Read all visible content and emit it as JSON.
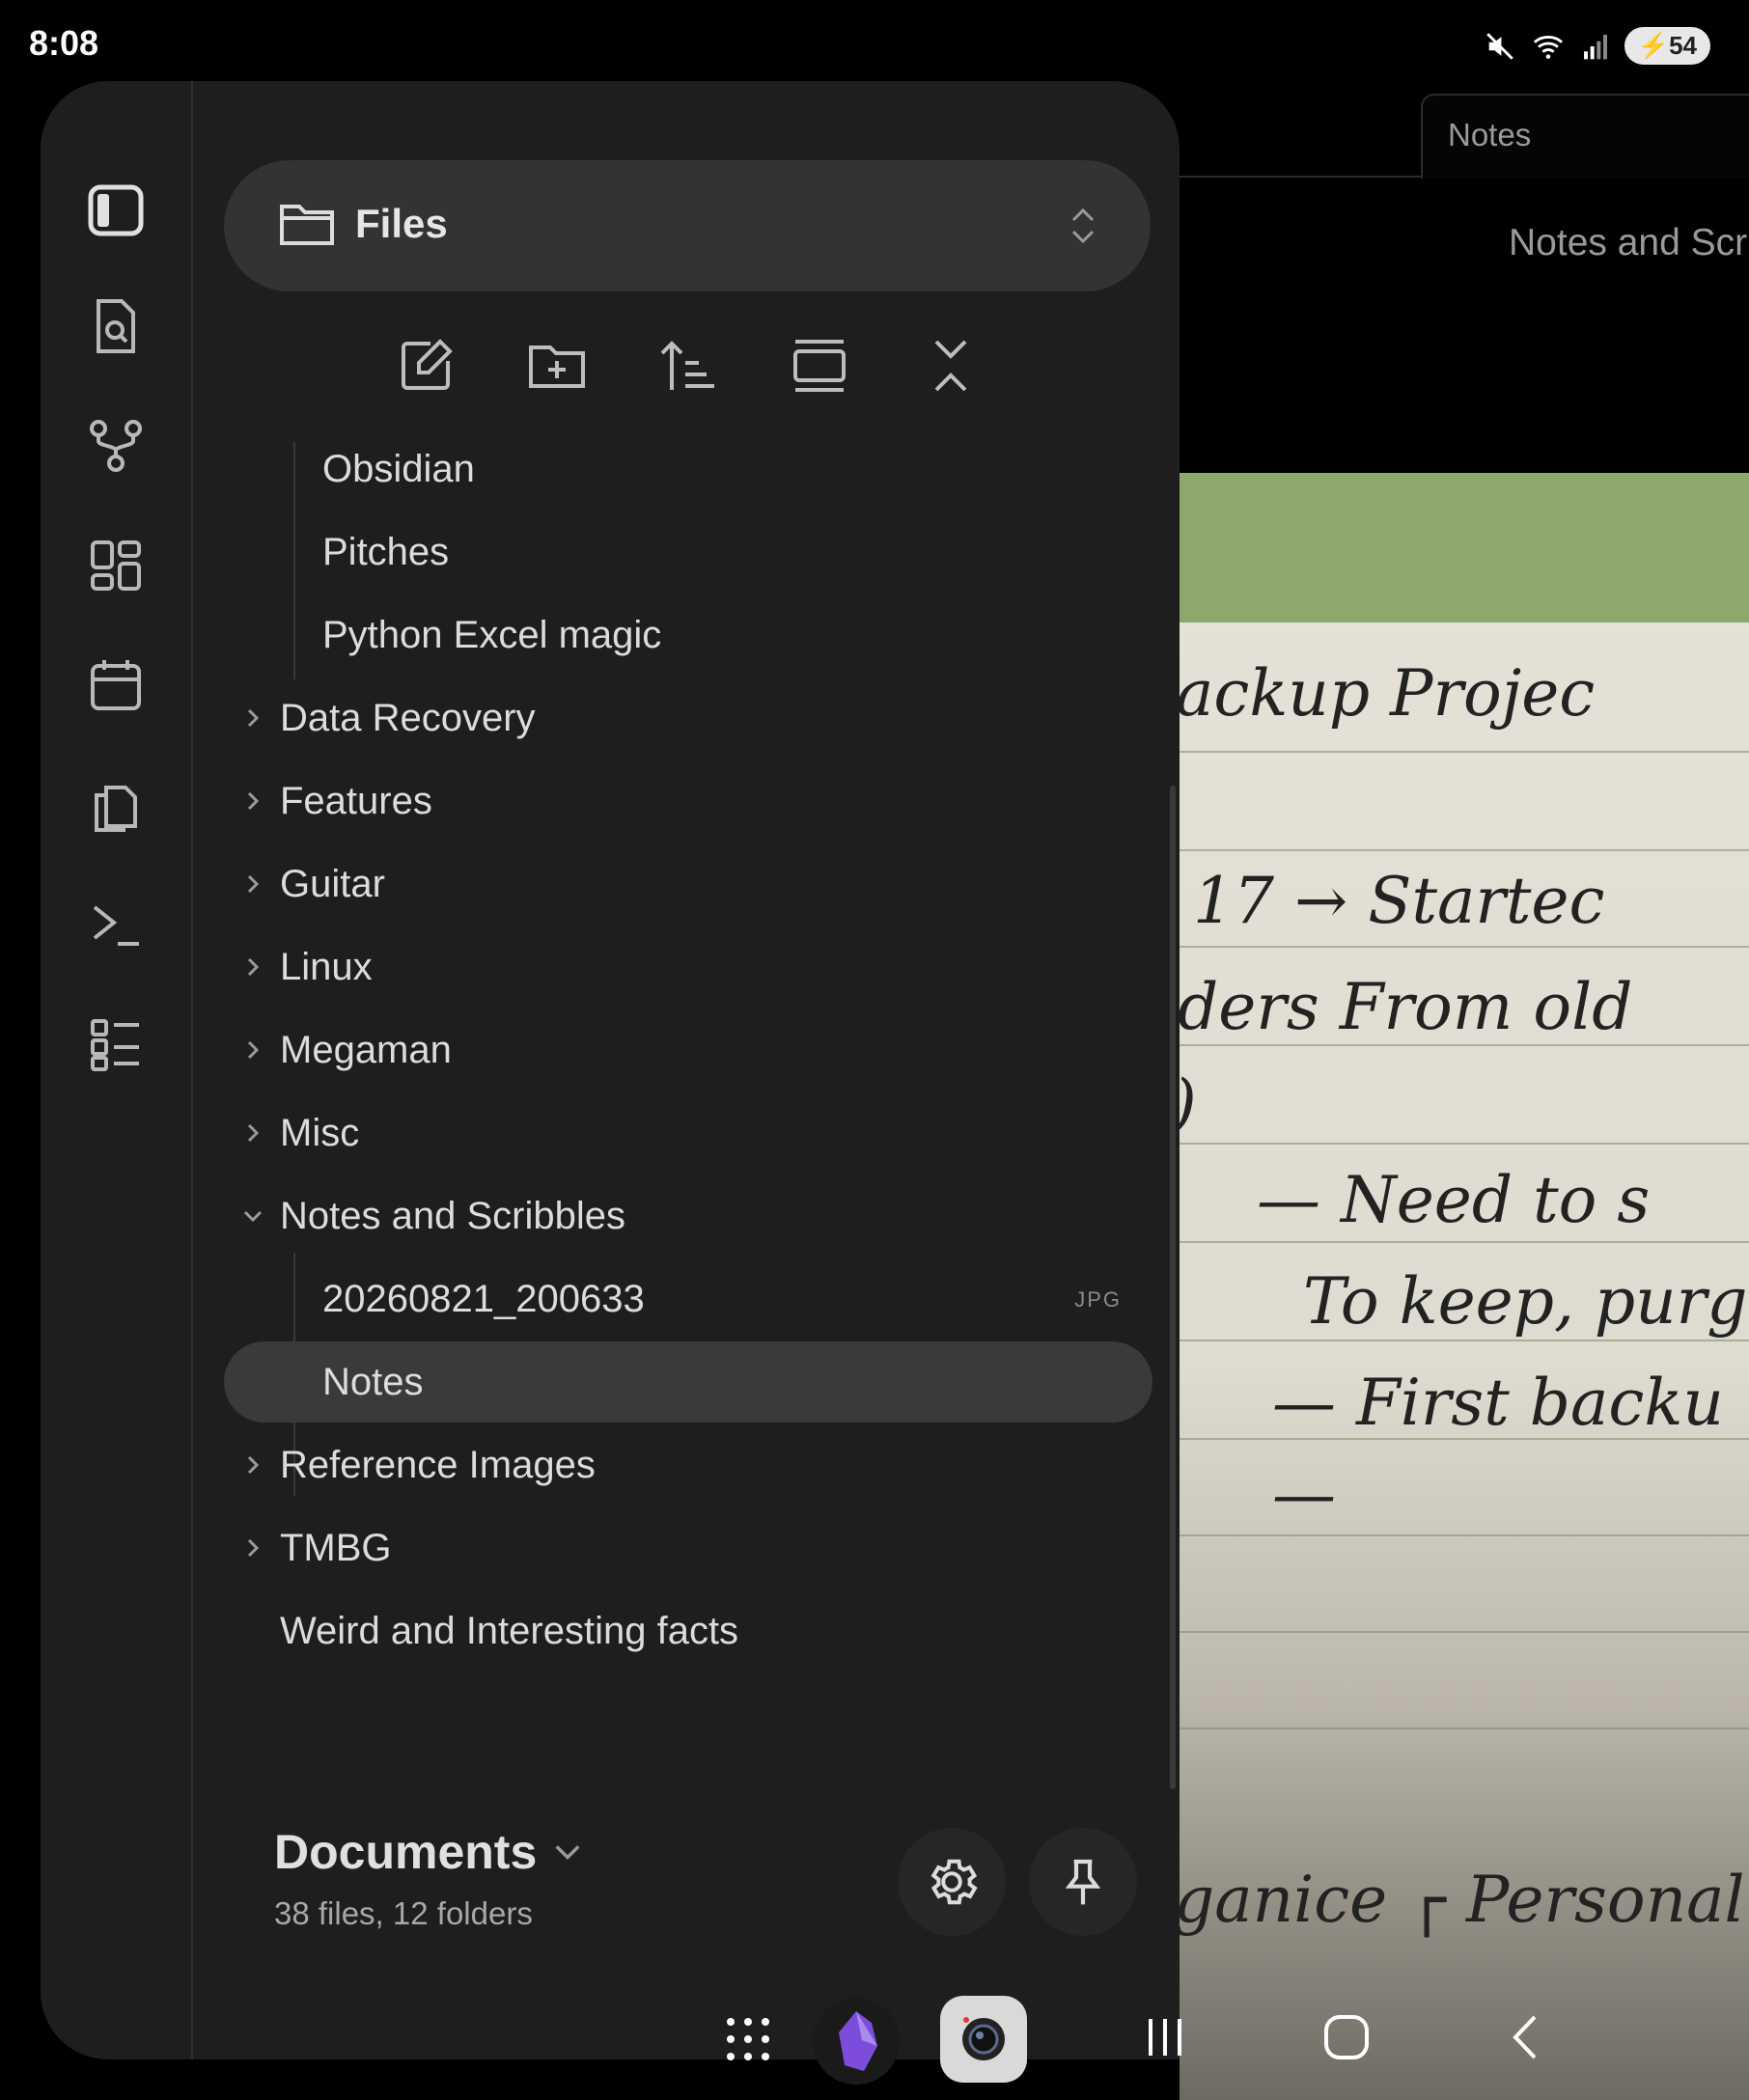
{
  "status": {
    "time": "8:08",
    "battery": "54"
  },
  "note_view": {
    "tab_title": "Notes",
    "heading": "Notes and Scr",
    "handwriting": [
      "ackup  Projec",
      "17  →  Startec",
      "ders  From  old",
      ")",
      "— Need  to  s",
      "To  keep,  purg",
      "—  First  backu",
      "—",
      "ganice  ┌  Personal"
    ]
  },
  "sidebar": {
    "rail_icons": [
      "sidebar-toggle-icon",
      "search-file-icon",
      "graph-view-icon",
      "canvas-icon",
      "calendar-icon",
      "copy-icon",
      "terminal-icon",
      "outline-icon"
    ],
    "header_title": "Files",
    "toolbar": [
      "new-note-icon",
      "new-folder-icon",
      "sort-icon",
      "collapse-view-icon",
      "collapse-all-icon"
    ],
    "tree": [
      {
        "label": "Obsidian",
        "type": "file",
        "depth": 1
      },
      {
        "label": "Pitches",
        "type": "file",
        "depth": 1
      },
      {
        "label": "Python Excel magic",
        "type": "file",
        "depth": 1
      },
      {
        "label": "Data Recovery",
        "type": "folder",
        "expanded": false,
        "depth": 0
      },
      {
        "label": "Features",
        "type": "folder",
        "expanded": false,
        "depth": 0
      },
      {
        "label": "Guitar",
        "type": "folder",
        "expanded": false,
        "depth": 0
      },
      {
        "label": "Linux",
        "type": "folder",
        "expanded": false,
        "depth": 0
      },
      {
        "label": "Megaman",
        "type": "folder",
        "expanded": false,
        "depth": 0
      },
      {
        "label": "Misc",
        "type": "folder",
        "expanded": false,
        "depth": 0
      },
      {
        "label": "Notes and Scribbles",
        "type": "folder",
        "expanded": true,
        "depth": 0
      },
      {
        "label": "20260821_200633",
        "type": "file",
        "ext": "JPG",
        "depth": 1
      },
      {
        "label": "Notes",
        "type": "file",
        "active": true,
        "depth": 1
      },
      {
        "label": "Reference Images",
        "type": "folder",
        "expanded": false,
        "depth": 0
      },
      {
        "label": "TMBG",
        "type": "folder",
        "expanded": false,
        "depth": 0
      },
      {
        "label": "Weird and Interesting facts",
        "type": "file",
        "depth": 0
      }
    ],
    "vault": {
      "name": "Documents",
      "stats": "38 files, 12 folders"
    }
  },
  "navbar": {
    "items": [
      "app-drawer-icon",
      "obsidian-app-icon",
      "camera-app-icon",
      "recents-icon",
      "home-icon",
      "back-icon"
    ]
  }
}
